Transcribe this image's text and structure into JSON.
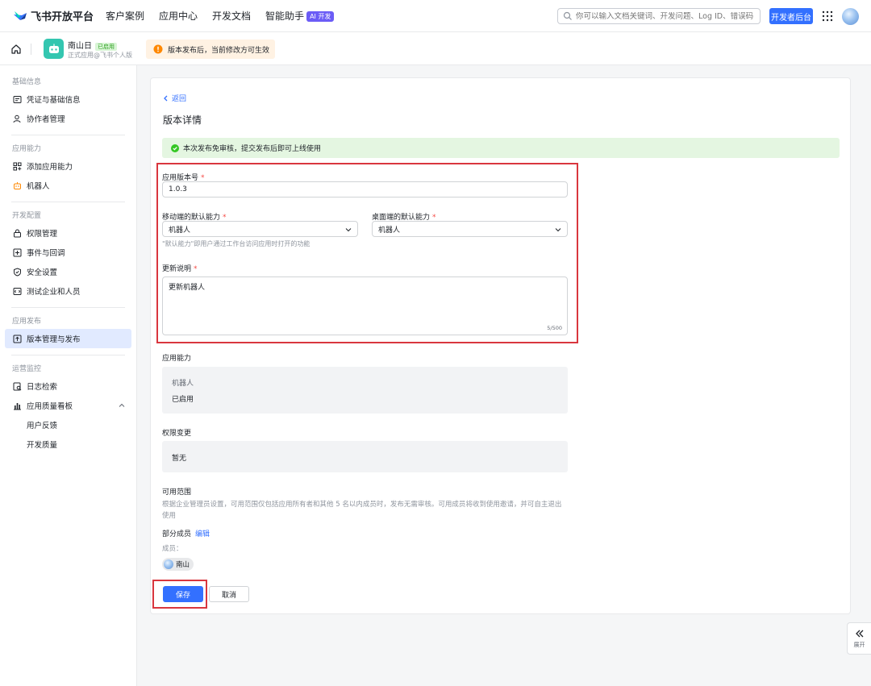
{
  "brand": {
    "name": "飞书开放平台"
  },
  "nav": {
    "links": [
      "客户案例",
      "应用中心",
      "开发文档",
      "智能助手"
    ],
    "ai_badge": "AI 开发",
    "search_placeholder": "你可以输入文档关键词、开发问题、Log ID、错误码",
    "dev_console": "开发者后台"
  },
  "app": {
    "name": "南山日",
    "status": "已启用",
    "subtitle": "正式应用@飞书个人版",
    "notice": "版本发布后，当前修改方可生效"
  },
  "sidebar": {
    "groups": [
      {
        "title": "基础信息",
        "items": [
          {
            "label": "凭证与基础信息",
            "icon": "credential-icon"
          },
          {
            "label": "协作者管理",
            "icon": "person-icon"
          }
        ]
      },
      {
        "title": "应用能力",
        "items": [
          {
            "label": "添加应用能力",
            "icon": "add-capability-icon"
          },
          {
            "label": "机器人",
            "icon": "robot-icon"
          }
        ]
      },
      {
        "title": "开发配置",
        "items": [
          {
            "label": "权限管理",
            "icon": "lock-icon"
          },
          {
            "label": "事件与回调",
            "icon": "event-icon"
          },
          {
            "label": "安全设置",
            "icon": "shield-icon"
          },
          {
            "label": "测试企业和人员",
            "icon": "test-icon"
          }
        ]
      },
      {
        "title": "应用发布",
        "items": [
          {
            "label": "版本管理与发布",
            "icon": "upload-icon",
            "active": true
          }
        ]
      },
      {
        "title": "运营监控",
        "items": [
          {
            "label": "日志检索",
            "icon": "log-icon"
          },
          {
            "label": "应用质量看板",
            "icon": "chart-icon",
            "expanded": true
          },
          {
            "label": "用户反馈",
            "sub": true
          },
          {
            "label": "开发质量",
            "sub": true
          }
        ]
      }
    ]
  },
  "main": {
    "back": "返回",
    "title": "版本详情",
    "success": "本次发布免审核，提交发布后即可上线使用",
    "version_label": "应用版本号",
    "version_value": "1.0.3",
    "mobile_label": "移动端的默认能力",
    "mobile_value": "机器人",
    "desktop_label": "桌面端的默认能力",
    "desktop_value": "机器人",
    "default_hint": "\"默认能力\"即用户通过工作台访问应用时打开的功能",
    "notes_label": "更新说明",
    "notes_value": "更新机器人",
    "notes_counter": "5/500",
    "capability_title": "应用能力",
    "capability_name": "机器人",
    "capability_status": "已启用",
    "permission_title": "权限变更",
    "permission_value": "暂无",
    "scope_title": "可用范围",
    "scope_desc": "根据企业管理员设置，可用范围仅包括应用所有者和其他 5 名以内成员时，发布无需审核。可用成员将收到使用邀请，并可自主退出使用",
    "scope_partial": "部分成员",
    "scope_edit": "编辑",
    "members_label": "成员：",
    "member_name": "南山",
    "save": "保存",
    "cancel": "取消"
  },
  "expand": {
    "label": "展开"
  },
  "colors": {
    "accent": "#3370ff",
    "highlight": "#d9363e",
    "success_bg": "#e4f6e1"
  }
}
